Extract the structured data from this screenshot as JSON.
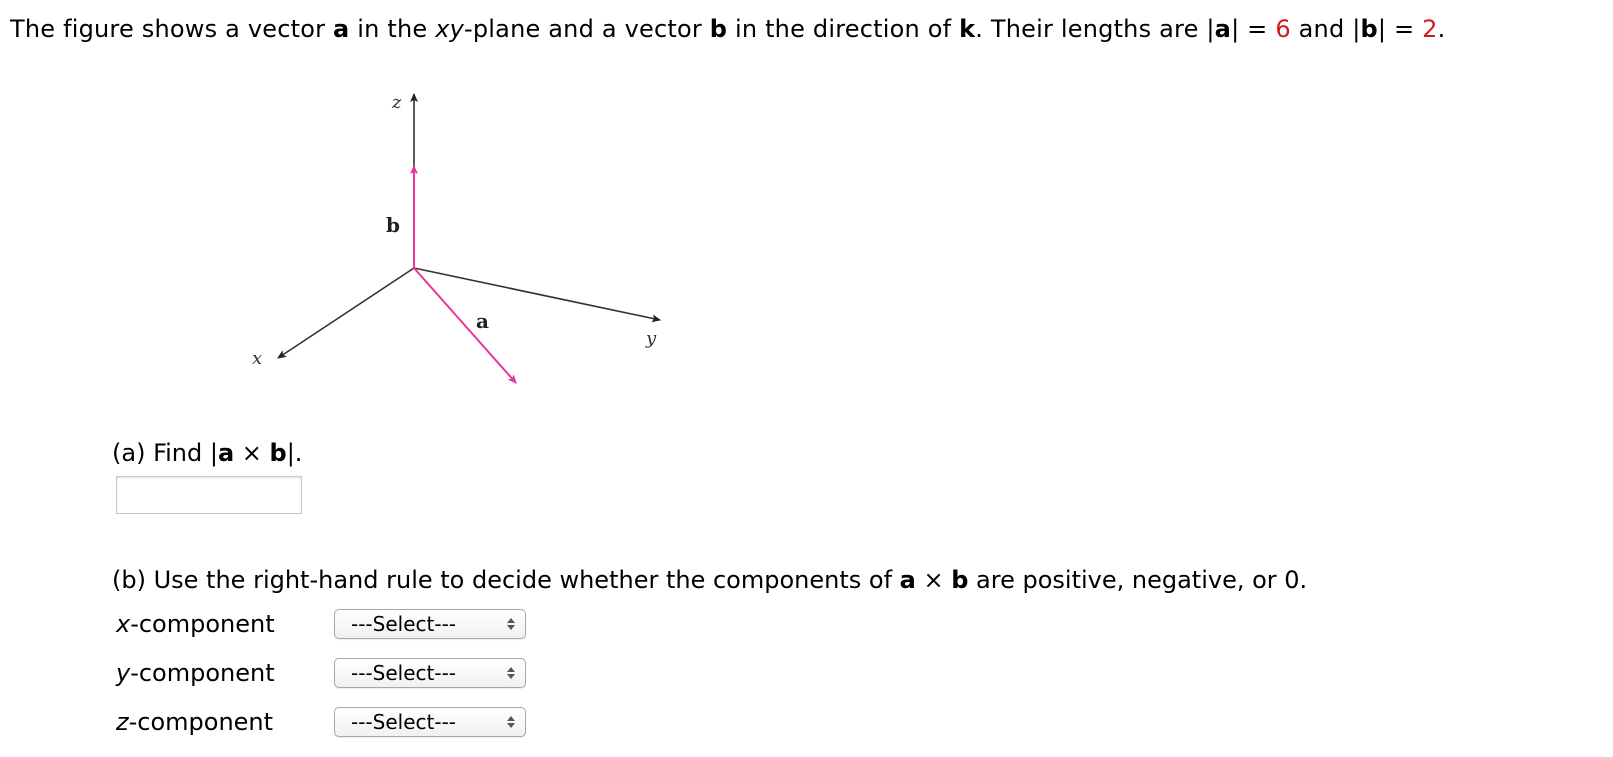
{
  "intro": {
    "t1": "The figure shows a vector ",
    "a": "a",
    "t2": " in the ",
    "xy": "xy",
    "t3": "-plane and a vector ",
    "b": "b",
    "t4": " in the direction of ",
    "k": "k",
    "t5": ". Their lengths are |",
    "t6": "| = ",
    "a_len": "6",
    "t7": " and |",
    "t8": "| = ",
    "b_len": "2",
    "t9": "."
  },
  "figure": {
    "axis_labels": {
      "x": "x",
      "y": "y",
      "z": "z"
    },
    "vector_labels": {
      "a": "a",
      "b": "b"
    },
    "colors": {
      "axis": "#333333",
      "vector": "#e8359c"
    }
  },
  "part_a": {
    "prefix": "(a) Find |",
    "a": "a",
    "times": " × ",
    "b": "b",
    "suffix": "|.",
    "answer_value": "",
    "answer_placeholder": ""
  },
  "part_b": {
    "prefix": "(b) Use the right-hand rule to decide whether the components of ",
    "a": "a",
    "times": " × ",
    "b": "b",
    "suffix": " are positive, negative, or 0.",
    "components": [
      {
        "var": "x",
        "label": "-component",
        "selected": "---Select---"
      },
      {
        "var": "y",
        "label": "-component",
        "selected": "---Select---"
      },
      {
        "var": "z",
        "label": "-component",
        "selected": "---Select---"
      }
    ]
  },
  "colors": {
    "given_values": "#d11b1b",
    "vector_pink": "#e8359c"
  }
}
